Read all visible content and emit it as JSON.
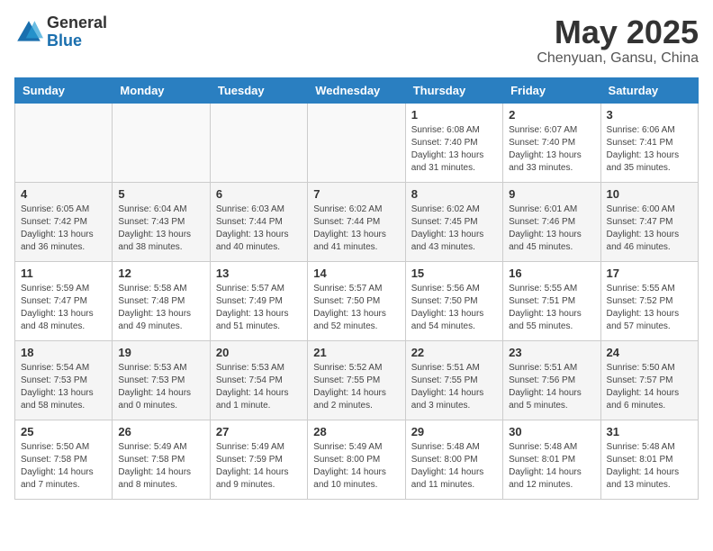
{
  "header": {
    "logo_general": "General",
    "logo_blue": "Blue",
    "month": "May 2025",
    "location": "Chenyuan, Gansu, China"
  },
  "days_of_week": [
    "Sunday",
    "Monday",
    "Tuesday",
    "Wednesday",
    "Thursday",
    "Friday",
    "Saturday"
  ],
  "weeks": [
    [
      {
        "day": "",
        "info": ""
      },
      {
        "day": "",
        "info": ""
      },
      {
        "day": "",
        "info": ""
      },
      {
        "day": "",
        "info": ""
      },
      {
        "day": "1",
        "info": "Sunrise: 6:08 AM\nSunset: 7:40 PM\nDaylight: 13 hours\nand 31 minutes."
      },
      {
        "day": "2",
        "info": "Sunrise: 6:07 AM\nSunset: 7:40 PM\nDaylight: 13 hours\nand 33 minutes."
      },
      {
        "day": "3",
        "info": "Sunrise: 6:06 AM\nSunset: 7:41 PM\nDaylight: 13 hours\nand 35 minutes."
      }
    ],
    [
      {
        "day": "4",
        "info": "Sunrise: 6:05 AM\nSunset: 7:42 PM\nDaylight: 13 hours\nand 36 minutes."
      },
      {
        "day": "5",
        "info": "Sunrise: 6:04 AM\nSunset: 7:43 PM\nDaylight: 13 hours\nand 38 minutes."
      },
      {
        "day": "6",
        "info": "Sunrise: 6:03 AM\nSunset: 7:44 PM\nDaylight: 13 hours\nand 40 minutes."
      },
      {
        "day": "7",
        "info": "Sunrise: 6:02 AM\nSunset: 7:44 PM\nDaylight: 13 hours\nand 41 minutes."
      },
      {
        "day": "8",
        "info": "Sunrise: 6:02 AM\nSunset: 7:45 PM\nDaylight: 13 hours\nand 43 minutes."
      },
      {
        "day": "9",
        "info": "Sunrise: 6:01 AM\nSunset: 7:46 PM\nDaylight: 13 hours\nand 45 minutes."
      },
      {
        "day": "10",
        "info": "Sunrise: 6:00 AM\nSunset: 7:47 PM\nDaylight: 13 hours\nand 46 minutes."
      }
    ],
    [
      {
        "day": "11",
        "info": "Sunrise: 5:59 AM\nSunset: 7:47 PM\nDaylight: 13 hours\nand 48 minutes."
      },
      {
        "day": "12",
        "info": "Sunrise: 5:58 AM\nSunset: 7:48 PM\nDaylight: 13 hours\nand 49 minutes."
      },
      {
        "day": "13",
        "info": "Sunrise: 5:57 AM\nSunset: 7:49 PM\nDaylight: 13 hours\nand 51 minutes."
      },
      {
        "day": "14",
        "info": "Sunrise: 5:57 AM\nSunset: 7:50 PM\nDaylight: 13 hours\nand 52 minutes."
      },
      {
        "day": "15",
        "info": "Sunrise: 5:56 AM\nSunset: 7:50 PM\nDaylight: 13 hours\nand 54 minutes."
      },
      {
        "day": "16",
        "info": "Sunrise: 5:55 AM\nSunset: 7:51 PM\nDaylight: 13 hours\nand 55 minutes."
      },
      {
        "day": "17",
        "info": "Sunrise: 5:55 AM\nSunset: 7:52 PM\nDaylight: 13 hours\nand 57 minutes."
      }
    ],
    [
      {
        "day": "18",
        "info": "Sunrise: 5:54 AM\nSunset: 7:53 PM\nDaylight: 13 hours\nand 58 minutes."
      },
      {
        "day": "19",
        "info": "Sunrise: 5:53 AM\nSunset: 7:53 PM\nDaylight: 14 hours\nand 0 minutes."
      },
      {
        "day": "20",
        "info": "Sunrise: 5:53 AM\nSunset: 7:54 PM\nDaylight: 14 hours\nand 1 minute."
      },
      {
        "day": "21",
        "info": "Sunrise: 5:52 AM\nSunset: 7:55 PM\nDaylight: 14 hours\nand 2 minutes."
      },
      {
        "day": "22",
        "info": "Sunrise: 5:51 AM\nSunset: 7:55 PM\nDaylight: 14 hours\nand 3 minutes."
      },
      {
        "day": "23",
        "info": "Sunrise: 5:51 AM\nSunset: 7:56 PM\nDaylight: 14 hours\nand 5 minutes."
      },
      {
        "day": "24",
        "info": "Sunrise: 5:50 AM\nSunset: 7:57 PM\nDaylight: 14 hours\nand 6 minutes."
      }
    ],
    [
      {
        "day": "25",
        "info": "Sunrise: 5:50 AM\nSunset: 7:58 PM\nDaylight: 14 hours\nand 7 minutes."
      },
      {
        "day": "26",
        "info": "Sunrise: 5:49 AM\nSunset: 7:58 PM\nDaylight: 14 hours\nand 8 minutes."
      },
      {
        "day": "27",
        "info": "Sunrise: 5:49 AM\nSunset: 7:59 PM\nDaylight: 14 hours\nand 9 minutes."
      },
      {
        "day": "28",
        "info": "Sunrise: 5:49 AM\nSunset: 8:00 PM\nDaylight: 14 hours\nand 10 minutes."
      },
      {
        "day": "29",
        "info": "Sunrise: 5:48 AM\nSunset: 8:00 PM\nDaylight: 14 hours\nand 11 minutes."
      },
      {
        "day": "30",
        "info": "Sunrise: 5:48 AM\nSunset: 8:01 PM\nDaylight: 14 hours\nand 12 minutes."
      },
      {
        "day": "31",
        "info": "Sunrise: 5:48 AM\nSunset: 8:01 PM\nDaylight: 14 hours\nand 13 minutes."
      }
    ]
  ]
}
